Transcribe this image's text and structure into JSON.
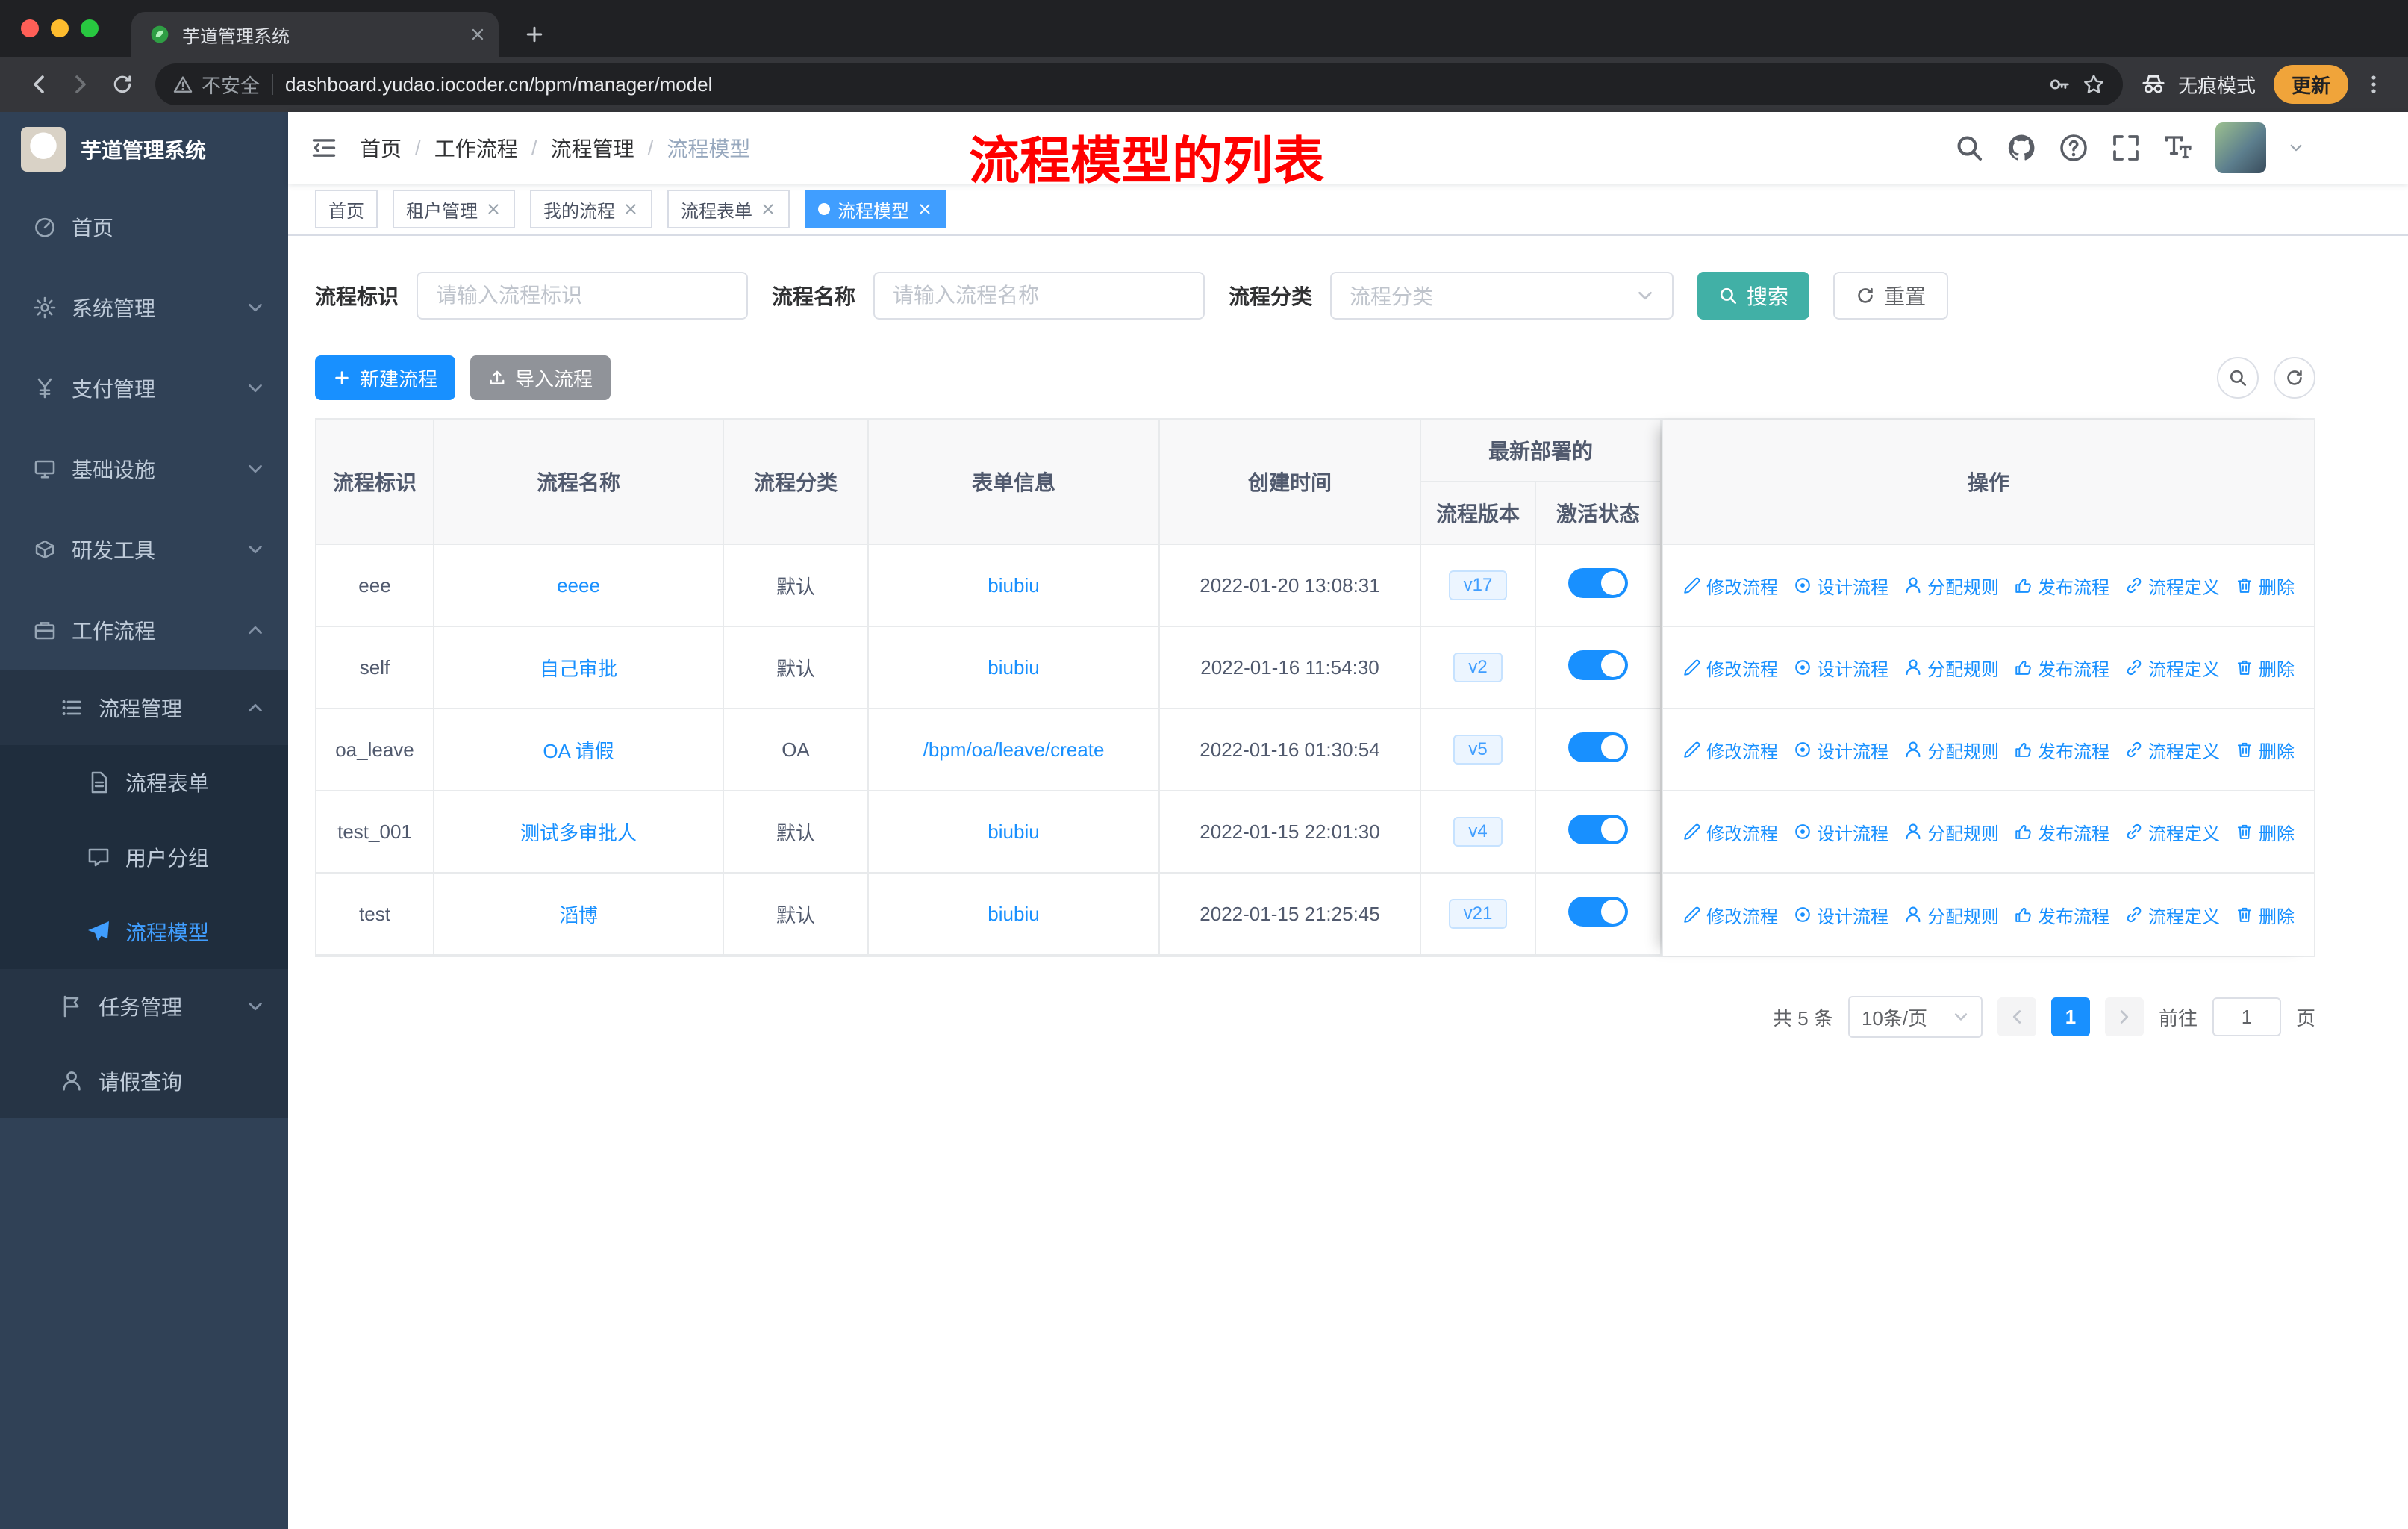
{
  "colors": {
    "primary_blue": "#1890ff",
    "active_blue": "#409eff",
    "search_teal": "#41b0a6",
    "sidebar_bg": "#304156",
    "annotation_red": "#ff0000"
  },
  "browser": {
    "tab_title": "芋道管理系统",
    "security_label": "不安全",
    "url": "dashboard.yudao.iocoder.cn/bpm/manager/model",
    "incognito_label": "无痕模式",
    "update_label": "更新"
  },
  "sidebar": {
    "title": "芋道管理系统",
    "items": [
      {
        "label": "首页"
      },
      {
        "label": "系统管理"
      },
      {
        "label": "支付管理"
      },
      {
        "label": "基础设施"
      },
      {
        "label": "研发工具"
      },
      {
        "label": "工作流程"
      }
    ],
    "process_group": {
      "label": "流程管理",
      "children": [
        {
          "label": "流程表单"
        },
        {
          "label": "用户分组"
        },
        {
          "label": "流程模型"
        }
      ]
    },
    "tail_items": [
      {
        "label": "任务管理"
      },
      {
        "label": "请假查询"
      }
    ]
  },
  "header": {
    "breadcrumb": [
      "首页",
      "工作流程",
      "流程管理",
      "流程模型"
    ],
    "annotation": "流程模型的列表"
  },
  "tags": [
    {
      "label": "首页",
      "closable": false,
      "active": false
    },
    {
      "label": "租户管理",
      "closable": true,
      "active": false
    },
    {
      "label": "我的流程",
      "closable": true,
      "active": false
    },
    {
      "label": "流程表单",
      "closable": true,
      "active": false
    },
    {
      "label": "流程模型",
      "closable": true,
      "active": true
    }
  ],
  "filters": {
    "id_label": "流程标识",
    "id_placeholder": "请输入流程标识",
    "name_label": "流程名称",
    "name_placeholder": "请输入流程名称",
    "category_label": "流程分类",
    "category_placeholder": "流程分类",
    "search": "搜索",
    "reset": "重置"
  },
  "toolbar": {
    "create": "新建流程",
    "import": "导入流程"
  },
  "table": {
    "headers": {
      "id": "流程标识",
      "name": "流程名称",
      "category": "流程分类",
      "form": "表单信息",
      "created": "创建时间",
      "deploy_group": "最新部署的",
      "version": "流程版本",
      "status": "激活状态",
      "actions": "操作"
    },
    "action_labels": [
      "修改流程",
      "设计流程",
      "分配规则",
      "发布流程",
      "流程定义",
      "删除"
    ],
    "rows": [
      {
        "id": "eee",
        "name": "eeee",
        "category": "默认",
        "form": "biubiu",
        "created": "2022-01-20 13:08:31",
        "version": "v17",
        "status_on": true
      },
      {
        "id": "self",
        "name": "自己审批",
        "category": "默认",
        "form": "biubiu",
        "created": "2022-01-16 11:54:30",
        "version": "v2",
        "status_on": true
      },
      {
        "id": "oa_leave",
        "name": "OA 请假",
        "category": "OA",
        "form": "/bpm/oa/leave/create",
        "created": "2022-01-16 01:30:54",
        "version": "v5",
        "status_on": true
      },
      {
        "id": "test_001",
        "name": "测试多审批人",
        "category": "默认",
        "form": "biubiu",
        "created": "2022-01-15 22:01:30",
        "version": "v4",
        "status_on": true
      },
      {
        "id": "test",
        "name": "滔博",
        "category": "默认",
        "form": "biubiu",
        "created": "2022-01-15 21:25:45",
        "version": "v21",
        "status_on": true
      }
    ]
  },
  "pagination": {
    "total": "共 5 条",
    "page_size": "10条/页",
    "page": "1",
    "goto_label": "前往",
    "goto_value": "1",
    "page_unit": "页"
  }
}
